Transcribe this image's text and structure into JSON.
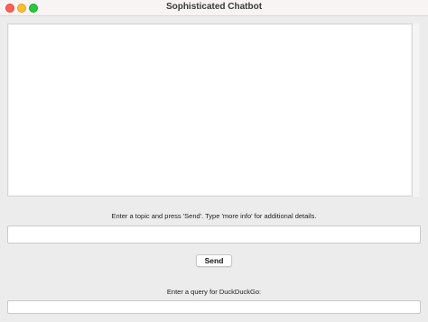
{
  "window": {
    "title": "Sophisticated Chatbot"
  },
  "chat": {
    "display_text": ""
  },
  "topic": {
    "instruction": "Enter a topic and press 'Send'. Type 'more info' for additional details.",
    "input_value": "",
    "placeholder": ""
  },
  "actions": {
    "send_label": "Send"
  },
  "duckduckgo": {
    "label": "Enter a query for DuckDuckGo:",
    "input_value": "",
    "placeholder": ""
  }
}
